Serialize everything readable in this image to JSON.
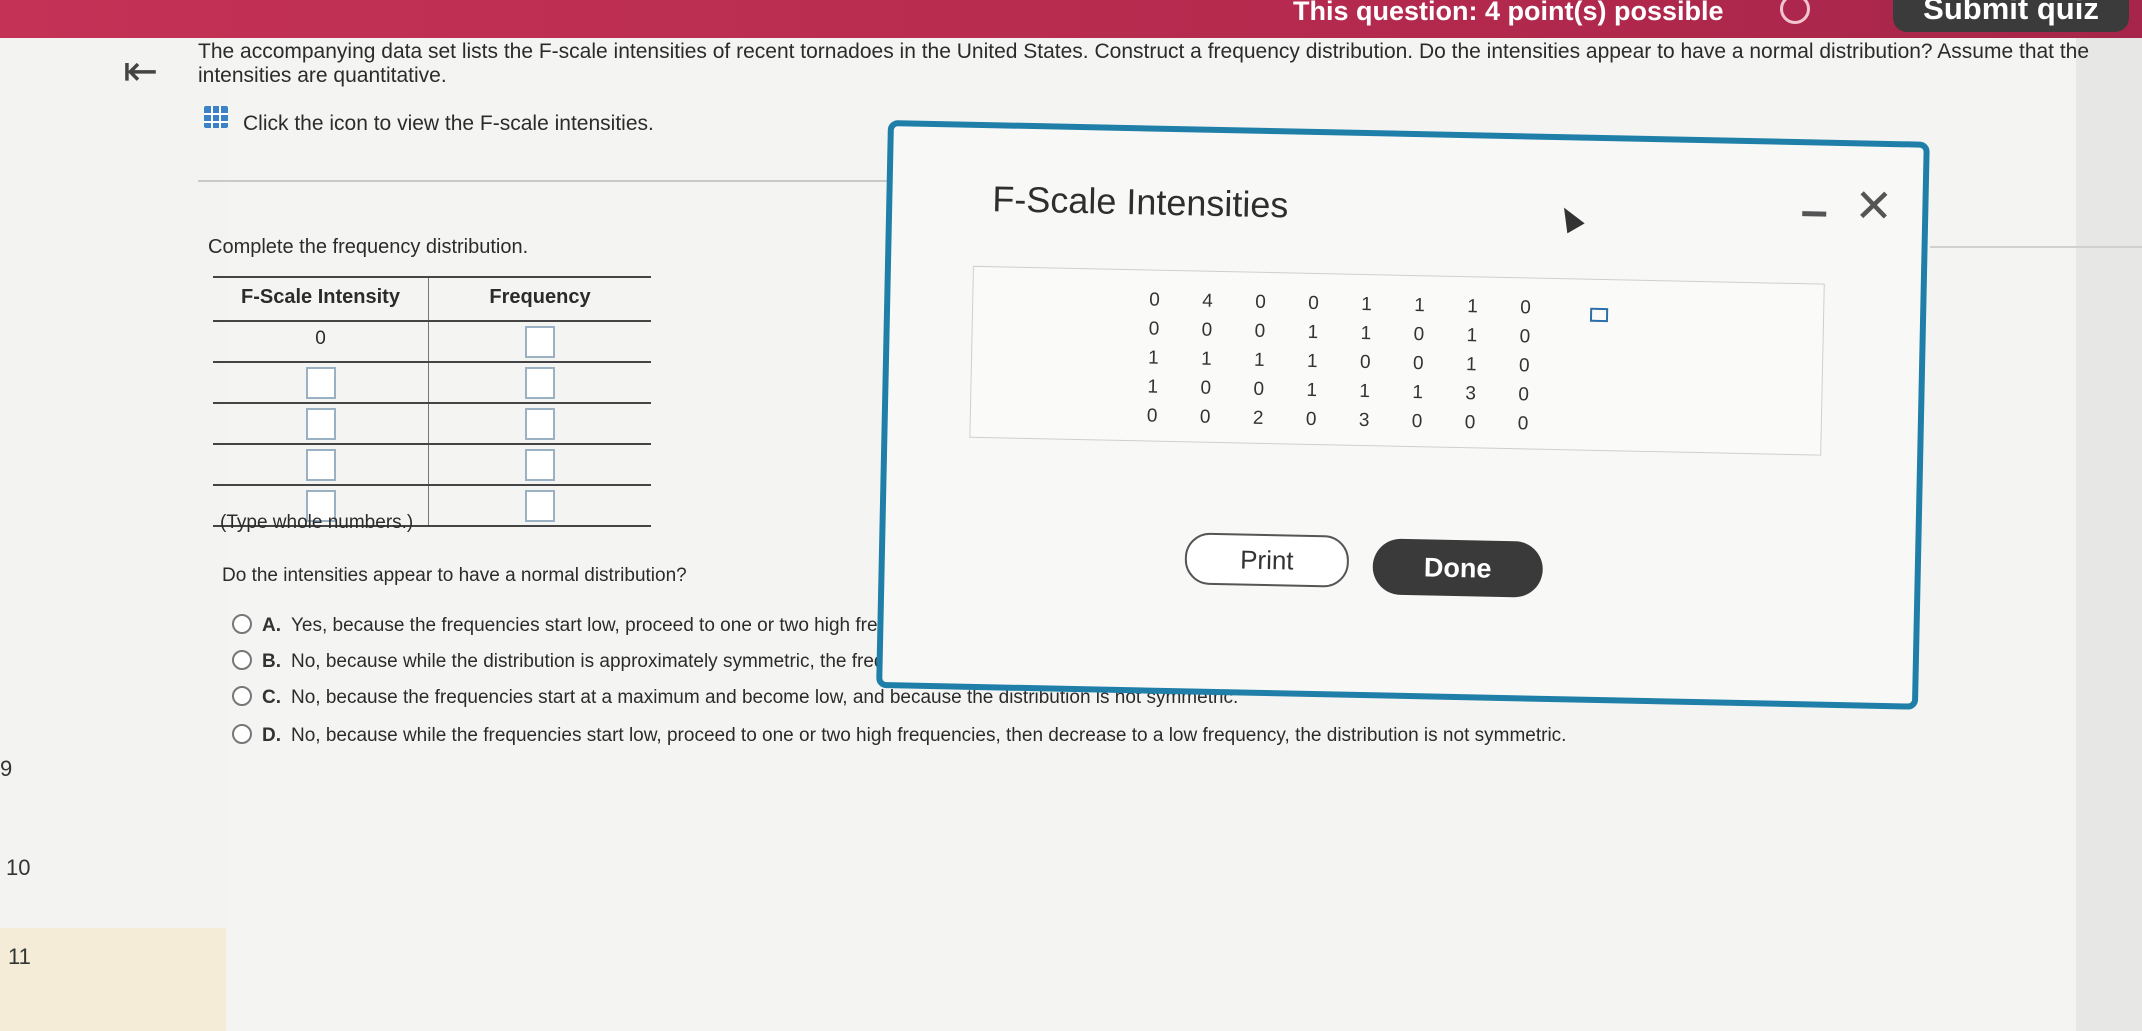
{
  "header": {
    "points_text": "This question: 4 point(s) possible",
    "submit_label": "Submit quiz"
  },
  "sidebar": {
    "question_numbers": [
      "9",
      "10",
      "11"
    ]
  },
  "question": {
    "back_icon": "back-to-first-icon",
    "text": "The accompanying data set lists the F-scale intensities of recent tornadoes in the United States. Construct a frequency distribution. Do the intensities appear to have a normal distribution? Assume that the intensities are quantitative.",
    "data_icon": "table-grid-icon",
    "click_text": "Click the icon to view the F-scale intensities."
  },
  "freq_table": {
    "instruction": "Complete the frequency distribution.",
    "col1_header": "F-Scale Intensity",
    "col2_header": "Frequency",
    "first_intensity": "0",
    "note": "(Type whole numbers.)"
  },
  "normality": {
    "prompt": "Do the intensities appear to have a normal distribution?",
    "choices": [
      {
        "letter": "A.",
        "text": "Yes, because the frequencies start low, proceed to one or two high frequencies, then decrease to a low frequency, and the distribution is approximately symmetric."
      },
      {
        "letter": "B.",
        "text": "No, because while the distribution is approximately symmetric, the frequencies start at a maximum and become low."
      },
      {
        "letter": "C.",
        "text": "No, because the frequencies start at a maximum and become low, and because the distribution is not symmetric."
      },
      {
        "letter": "D.",
        "text": "No, because while the frequencies start low, proceed to one or two high frequencies, then decrease to a low frequency, the distribution is not symmetric."
      }
    ]
  },
  "modal": {
    "title": "F-Scale Intensities",
    "minimize_icon": "minimize-icon",
    "close_icon": "close-icon",
    "copy_icon": "copy-icon",
    "data": [
      [
        "0",
        "4",
        "0",
        "0",
        "1",
        "1",
        "1",
        "0"
      ],
      [
        "0",
        "0",
        "0",
        "1",
        "1",
        "0",
        "1",
        "0"
      ],
      [
        "1",
        "1",
        "1",
        "1",
        "0",
        "0",
        "1",
        "0"
      ],
      [
        "1",
        "0",
        "0",
        "1",
        "1",
        "1",
        "3",
        "0"
      ],
      [
        "0",
        "0",
        "2",
        "0",
        "3",
        "0",
        "0",
        "0"
      ]
    ],
    "print_label": "Print",
    "done_label": "Done"
  }
}
